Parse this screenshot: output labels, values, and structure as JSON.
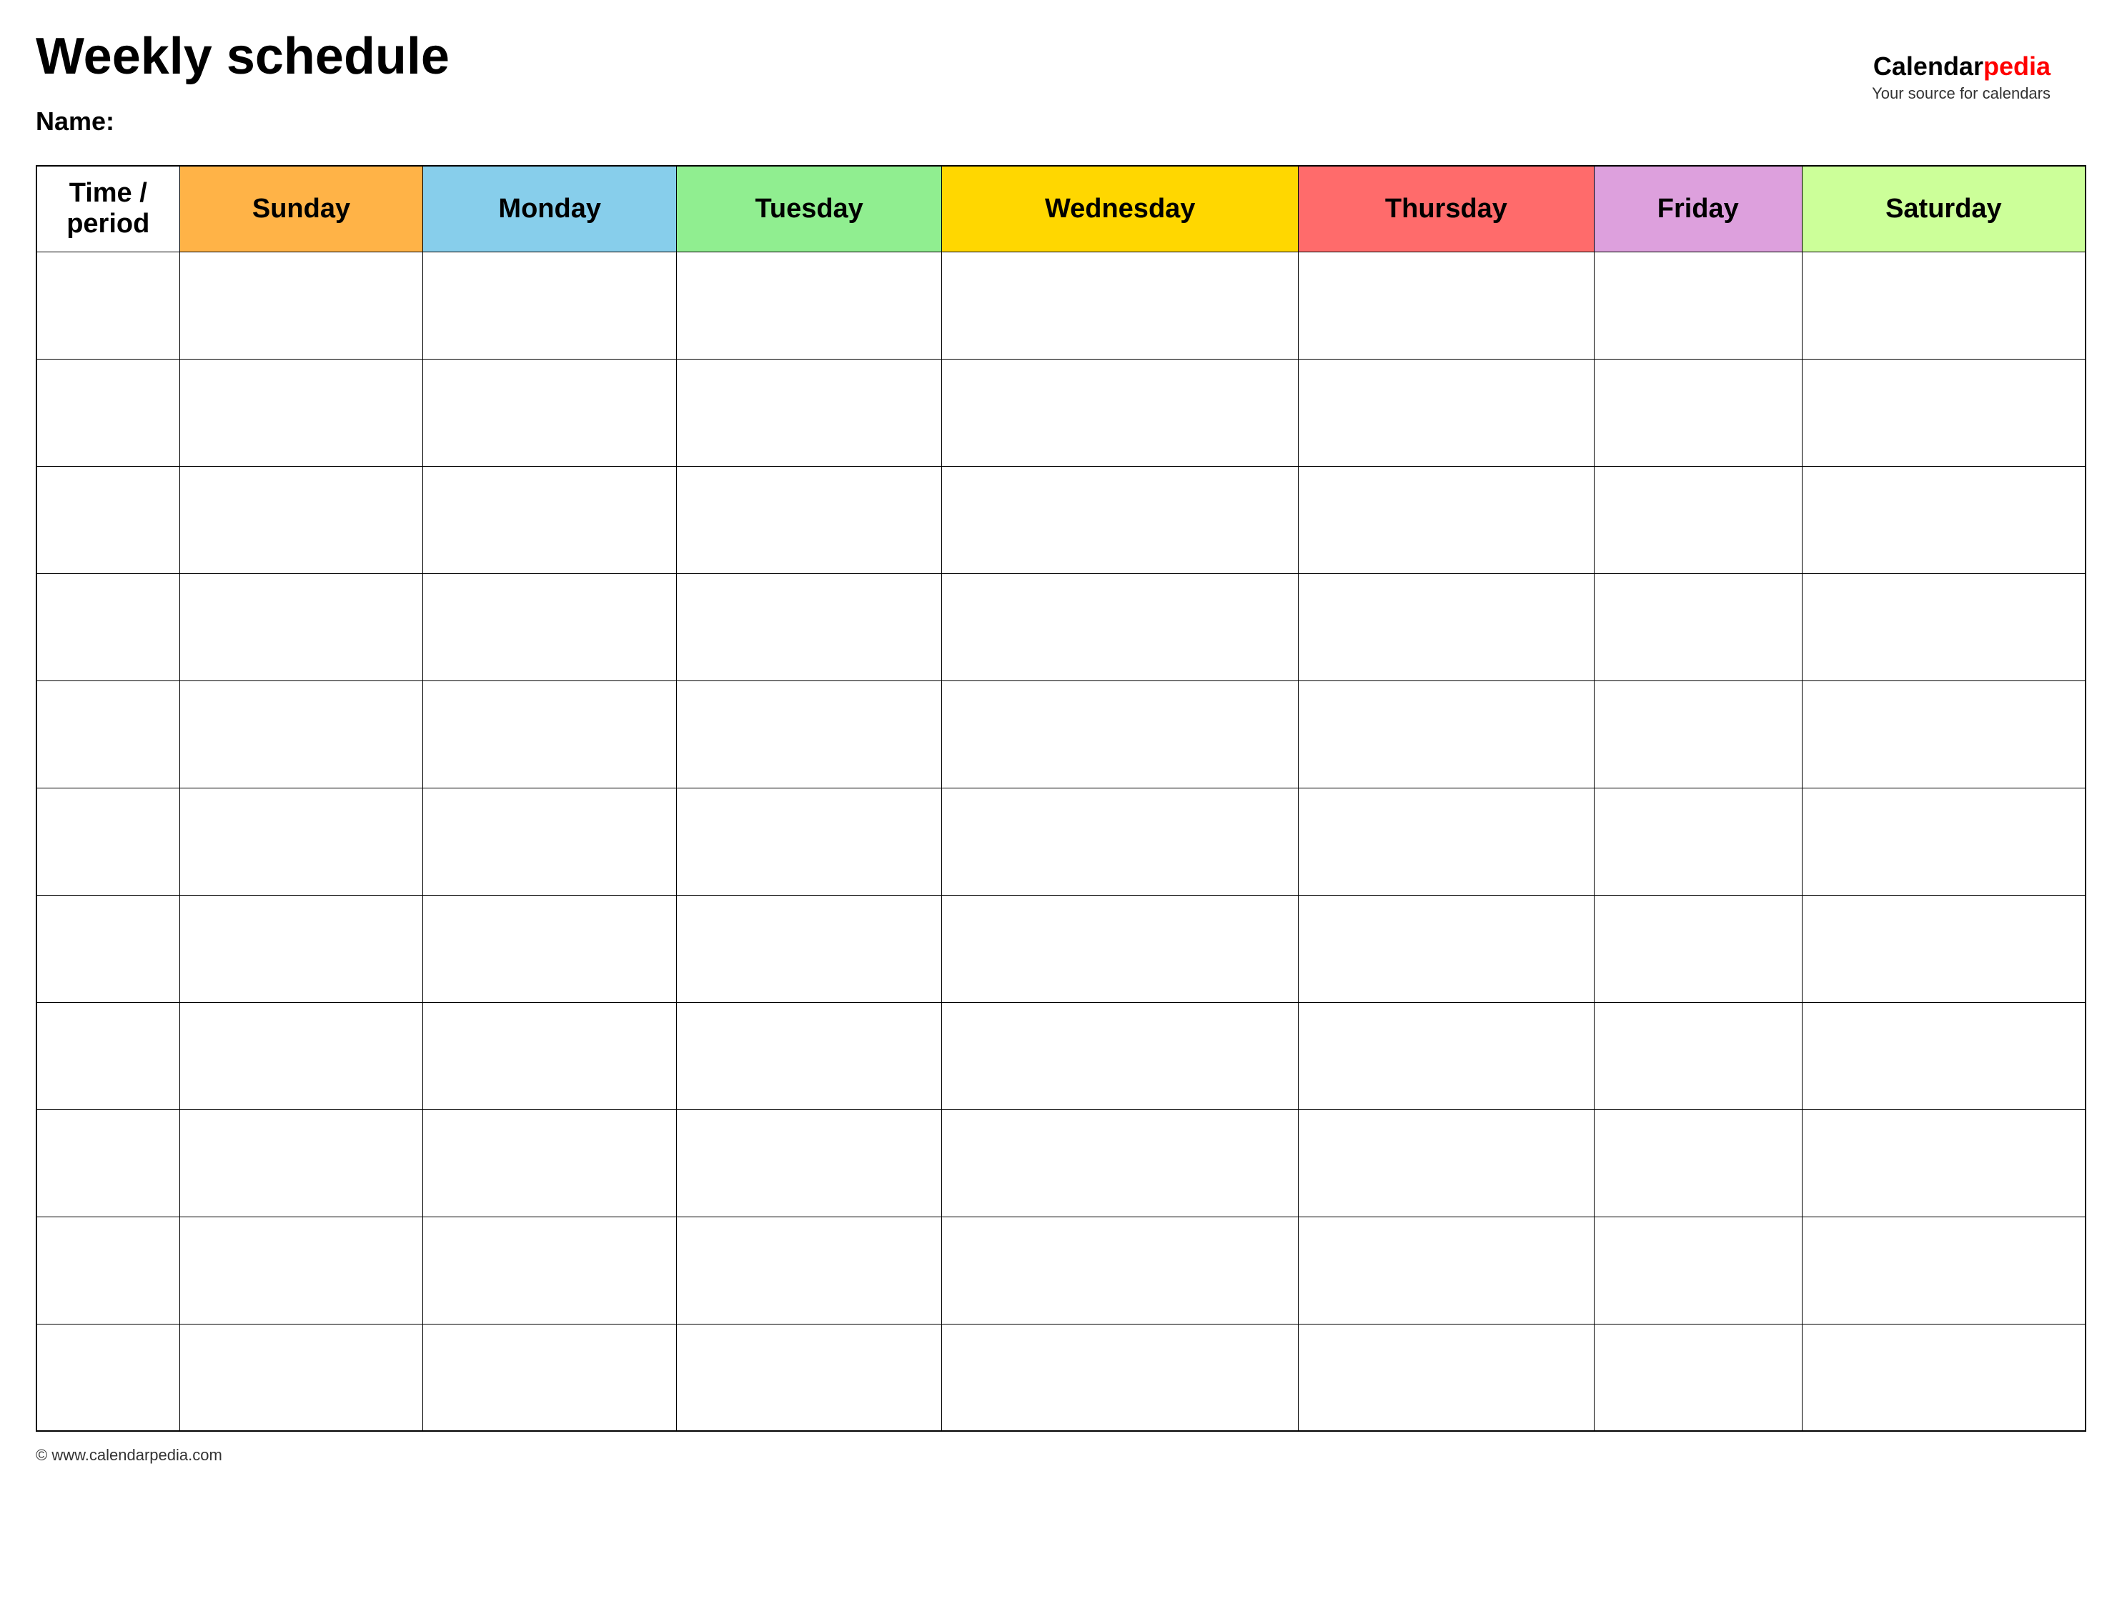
{
  "page": {
    "title": "Weekly schedule",
    "name_label": "Name:"
  },
  "brand": {
    "calendar": "Calendar",
    "pedia": "pedia",
    "tagline": "Your source for calendars",
    "website": "© www.calendarpedia.com"
  },
  "table": {
    "headers": [
      {
        "key": "time",
        "label": "Time / period",
        "color": "#ffffff"
      },
      {
        "key": "sunday",
        "label": "Sunday",
        "color": "#ffb347"
      },
      {
        "key": "monday",
        "label": "Monday",
        "color": "#87ceeb"
      },
      {
        "key": "tuesday",
        "label": "Tuesday",
        "color": "#90ee90"
      },
      {
        "key": "wednesday",
        "label": "Wednesday",
        "color": "#ffd700"
      },
      {
        "key": "thursday",
        "label": "Thursday",
        "color": "#ff6b6b"
      },
      {
        "key": "friday",
        "label": "Friday",
        "color": "#dda0dd"
      },
      {
        "key": "saturday",
        "label": "Saturday",
        "color": "#ccff99"
      }
    ],
    "row_count": 11
  }
}
